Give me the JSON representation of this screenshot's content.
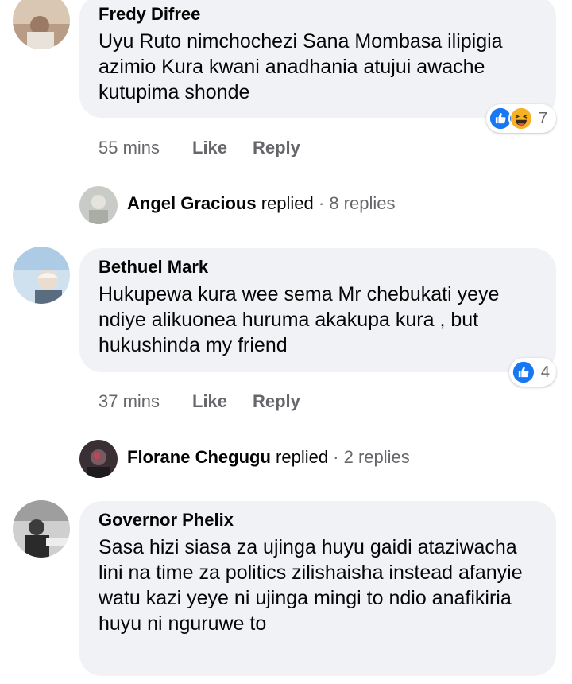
{
  "comments": [
    {
      "author": "Fredy Difree",
      "text": "Uyu Ruto nimchochezi Sana Mombasa ilipigia azimio Kura kwani anadhania atujui awache kutupima shonde",
      "time": "55 mins",
      "like_label": "Like",
      "reply_label": "Reply",
      "reaction_count": "7",
      "reaction_icons": [
        "like-icon",
        "haha-icon"
      ]
    },
    {
      "author": "Bethuel Mark",
      "text": "Hukupewa kura wee sema Mr chebukati yeye ndiye alikuonea huruma akakupa kura , but hukushinda my friend",
      "time": "37 mins",
      "like_label": "Like",
      "reply_label": "Reply",
      "reaction_count": "4",
      "reaction_icons": [
        "like-icon"
      ]
    },
    {
      "author": "Governor Phelix",
      "text": "Sasa hizi siasa za ujinga huyu gaidi ataziwacha lini na time za politics zilishaisha instead afanyie watu kazi yeye ni ujinga mingi to ndio anafikiria huyu ni nguruwe to"
    }
  ],
  "reply_threads": [
    {
      "name": "Angel Gracious",
      "verb": "replied",
      "separator": " · ",
      "count": "8 replies"
    },
    {
      "name": "Florane Chegugu",
      "verb": "replied",
      "separator": " · ",
      "count": "2 replies"
    }
  ],
  "colors": {
    "bubble_bg": "#f0f2f5",
    "meta_text": "#65676b",
    "like_blue": "#1877f2",
    "haha_yellow": "#f7b125"
  }
}
